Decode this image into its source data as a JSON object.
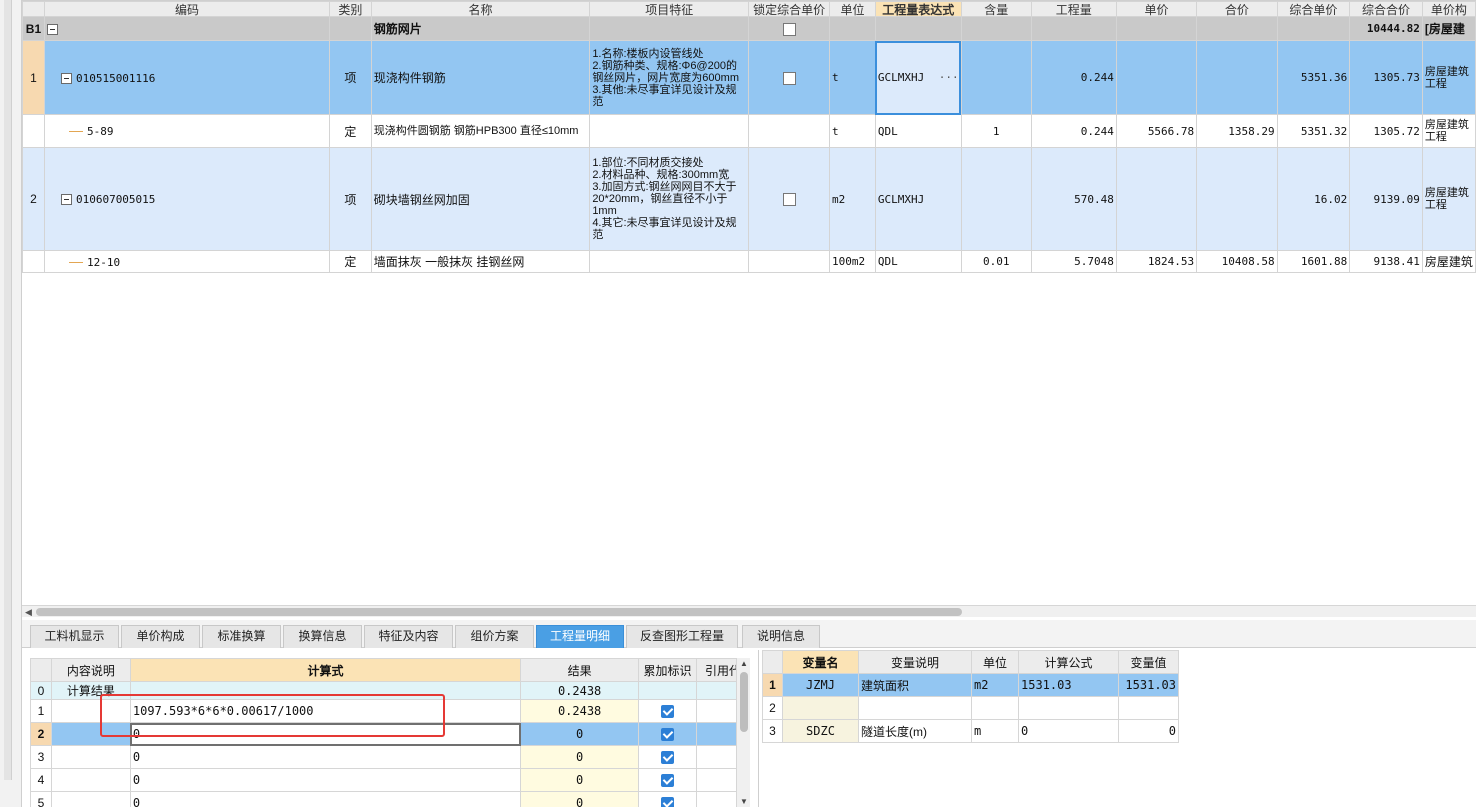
{
  "grid": {
    "headers": [
      "编码",
      "类别",
      "名称",
      "项目特征",
      "锁定综合单价",
      "单位",
      "工程量表达式",
      "含量",
      "工程量",
      "单价",
      "合价",
      "综合单价",
      "综合合价",
      "单价构"
    ],
    "group_row": {
      "id": "B1",
      "name": "钢筋网片",
      "total": "10444.82",
      "extra": "[房屋建"
    },
    "rows": [
      {
        "no": "1",
        "code": "010515001116",
        "type": "项",
        "name": "现浇构件钢筋",
        "features": "1.名称:楼板内设管线处\n2.钢筋种类、规格:Φ6@200的钢丝网片，网片宽度为600mm\n3.其他:未尽事宜详见设计及规范",
        "unit": "t",
        "expr": "GCLMXHJ",
        "content": "",
        "qty": "0.244",
        "price": "",
        "amount": "",
        "comp_price": "5351.36",
        "comp_amount": "1305.73",
        "extra": "房屋建筑工程"
      },
      {
        "no": "",
        "code": "5-89",
        "type": "定",
        "name": "现浇构件圆钢筋 钢筋HPB300 直径≤10mm",
        "features": "",
        "unit": "t",
        "expr": "QDL",
        "content": "1",
        "qty": "0.244",
        "price": "5566.78",
        "amount": "1358.29",
        "comp_price": "5351.32",
        "comp_amount": "1305.72",
        "extra": "房屋建筑工程"
      },
      {
        "no": "2",
        "code": "010607005015",
        "type": "项",
        "name": "砌块墙钢丝网加固",
        "features": "1.部位:不同材质交接处\n2.材料品种、规格:300mm宽\n3.加固方式:钢丝网网目不大于20*20mm，钢丝直径不小于1mm\n4.其它:未尽事宜详见设计及规范",
        "unit": "m2",
        "expr": "GCLMXHJ",
        "content": "",
        "qty": "570.48",
        "price": "",
        "amount": "",
        "comp_price": "16.02",
        "comp_amount": "9139.09",
        "extra": "房屋建筑工程"
      },
      {
        "no": "",
        "code": "12-10",
        "type": "定",
        "name": "墙面抹灰 一般抹灰 挂钢丝网",
        "features": "",
        "unit": "100m2",
        "expr": "QDL",
        "content": "0.01",
        "qty": "5.7048",
        "price": "1824.53",
        "amount": "10408.58",
        "comp_price": "1601.88",
        "comp_amount": "9138.41",
        "extra": "房屋建筑"
      }
    ],
    "ellipsis": "···"
  },
  "tabs": [
    "工料机显示",
    "单价构成",
    "标准换算",
    "换算信息",
    "特征及内容",
    "组价方案",
    "工程量明细",
    "反查图形工程量",
    "说明信息"
  ],
  "active_tab": "工程量明细",
  "detail": {
    "headers": [
      "",
      "内容说明",
      "计算式",
      "结果",
      "累加标识",
      "引用代"
    ],
    "rows": [
      {
        "no": "0",
        "desc": "计算结果",
        "formula": "",
        "result": "0.2438",
        "checked": false
      },
      {
        "no": "1",
        "desc": "",
        "formula": "1097.593*6*6*0.00617/1000",
        "result": "0.2438",
        "checked": true
      },
      {
        "no": "2",
        "desc": "",
        "formula": "0",
        "result": "0",
        "checked": true
      },
      {
        "no": "3",
        "desc": "",
        "formula": "0",
        "result": "0",
        "checked": true
      },
      {
        "no": "4",
        "desc": "",
        "formula": "0",
        "result": "0",
        "checked": true
      },
      {
        "no": "5",
        "desc": "",
        "formula": "0",
        "result": "0",
        "checked": true
      }
    ]
  },
  "variables": {
    "headers": [
      "",
      "变量名",
      "变量说明",
      "单位",
      "计算公式",
      "变量值"
    ],
    "rows": [
      {
        "no": "1",
        "name": "JZMJ",
        "desc": "建筑面积",
        "unit": "m2",
        "formula": "1531.03",
        "value": "1531.03"
      },
      {
        "no": "2",
        "name": "",
        "desc": "",
        "unit": "",
        "formula": "",
        "value": ""
      },
      {
        "no": "3",
        "name": "SDZC",
        "desc": "隧道长度(m)",
        "unit": "m",
        "formula": "0",
        "value": "0"
      }
    ]
  },
  "colors": {
    "selected_row": "#93c6f2",
    "light_row": "#dceafb",
    "active_tab": "#4a9fe4",
    "header_highlight": "#fbe3b5",
    "annotation": "#e53935"
  }
}
